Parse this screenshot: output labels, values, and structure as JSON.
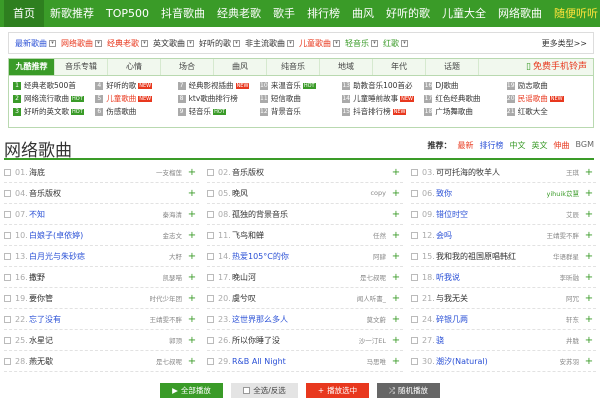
{
  "topnav": [
    "首页",
    "新歌推荐",
    "TOP500",
    "抖音歌曲",
    "经典老歌",
    "歌手",
    "排行榜",
    "曲风",
    "好听的歌",
    "儿童大全",
    "网络歌曲",
    "随便听听"
  ],
  "cats": [
    "最新歌曲",
    "网络歌曲",
    "经典老歌",
    "英文歌曲",
    "好听的歌",
    "非主流歌曲",
    "儿童歌曲",
    "轻音乐",
    "红歌"
  ],
  "cats_more": "更多类型>>",
  "tabs": [
    "九酷推荐",
    "音乐专辑",
    "心情",
    "场合",
    "曲风",
    "纯音乐",
    "地域",
    "年代",
    "话题"
  ],
  "free_ringtone": "免费手机铃声",
  "grid": [
    {
      "n": "1",
      "t": "经典老歌500首",
      "badge": ""
    },
    {
      "n": "4",
      "t": "好听的歌",
      "badge": "NEW"
    },
    {
      "n": "7",
      "t": "经典影视插曲",
      "badge": "NEW"
    },
    {
      "n": "10",
      "t": "来温音乐",
      "badge": "HOT"
    },
    {
      "n": "13",
      "t": "助教音乐100首必",
      "badge": ""
    },
    {
      "n": "16",
      "t": "DJ歌曲",
      "badge": ""
    },
    {
      "n": "19",
      "t": "励志歌曲",
      "badge": ""
    },
    {
      "n": "2",
      "t": "网络流行歌曲",
      "badge": "HOT"
    },
    {
      "n": "5",
      "t": "儿童歌曲",
      "badge": "NEW"
    },
    {
      "n": "8",
      "t": "ktv歌曲排行榜",
      "badge": ""
    },
    {
      "n": "11",
      "t": "短信歌曲",
      "badge": ""
    },
    {
      "n": "14",
      "t": "儿童睡前故事",
      "badge": "NEW"
    },
    {
      "n": "17",
      "t": "红色经典歌曲",
      "badge": ""
    },
    {
      "n": "20",
      "t": "民谣歌曲",
      "badge": "NEW"
    },
    {
      "n": "3",
      "t": "好听的英文歌",
      "badge": "HOT"
    },
    {
      "n": "6",
      "t": "伤感歌曲",
      "badge": ""
    },
    {
      "n": "9",
      "t": "轻音乐",
      "badge": "HOT"
    },
    {
      "n": "12",
      "t": "背景音乐",
      "badge": ""
    },
    {
      "n": "15",
      "t": "抖音排行榜",
      "badge": "NEW"
    },
    {
      "n": "18",
      "t": "广场舞歌曲",
      "badge": ""
    },
    {
      "n": "21",
      "t": "红歌大全",
      "badge": ""
    }
  ],
  "title": "网络歌曲",
  "rec_label": "推荐：",
  "rec_links": [
    "最新",
    "排行榜",
    "中文",
    "英文",
    "伸曲",
    "BGM"
  ],
  "songs": [
    {
      "num": "01.",
      "name": "海底",
      "artist": "一支榴莲"
    },
    {
      "num": "02.",
      "name": "音乐版权",
      "artist": ""
    },
    {
      "num": "03.",
      "name": "可可托海的牧羊人",
      "artist": "王琪"
    },
    {
      "num": "04.",
      "name": "音乐版权",
      "artist": ""
    },
    {
      "num": "05.",
      "name": "晚风",
      "artist": "copy"
    },
    {
      "num": "06.",
      "name": "致你",
      "artist": "yihuik苡慧"
    },
    {
      "num": "07.",
      "name": "不知",
      "artist": "秦海清"
    },
    {
      "num": "08.",
      "name": "孤独的背景音乐",
      "artist": ""
    },
    {
      "num": "09.",
      "name": "错位时空",
      "artist": "艾辰"
    },
    {
      "num": "10.",
      "name": "白娘子(卓依婷)",
      "artist": "金志文"
    },
    {
      "num": "11.",
      "name": "飞鸟和蝉",
      "artist": "任然"
    },
    {
      "num": "12.",
      "name": "会吗",
      "artist": "王靖雯不胖"
    },
    {
      "num": "13.",
      "name": "白月光与朱砂痣",
      "artist": "大籽"
    },
    {
      "num": "14.",
      "name": "热爱105°C的你",
      "artist": "阿肆"
    },
    {
      "num": "15.",
      "name": "我和我的祖国原唱韩红",
      "artist": "华语群星"
    },
    {
      "num": "16.",
      "name": "撒野",
      "artist": "凯瑟喵"
    },
    {
      "num": "17.",
      "name": "晚山河",
      "artist": "是七叔呢"
    },
    {
      "num": "18.",
      "name": "听我说",
      "artist": "李昕融"
    },
    {
      "num": "19.",
      "name": "要你管",
      "artist": "时代少年团"
    },
    {
      "num": "20.",
      "name": "虞兮叹",
      "artist": "闻人听書_"
    },
    {
      "num": "21.",
      "name": "与我无关",
      "artist": "阿冗"
    },
    {
      "num": "22.",
      "name": "忘了没有",
      "artist": "王靖雯不胖"
    },
    {
      "num": "23.",
      "name": "这世界那么多人",
      "artist": "莫文蔚"
    },
    {
      "num": "24.",
      "name": "碎银几两",
      "artist": "轩东"
    },
    {
      "num": "25.",
      "name": "水星记",
      "artist": "郭顶"
    },
    {
      "num": "26.",
      "name": "所以你睡了没",
      "artist": "沙一汀EL"
    },
    {
      "num": "27.",
      "name": "骁",
      "artist": "井胧"
    },
    {
      "num": "28.",
      "name": "燕无歇",
      "artist": "是七叔呢"
    },
    {
      "num": "29.",
      "name": "R&B All Night",
      "artist": "马思唯"
    },
    {
      "num": "30.",
      "name": "潮汐(Natural)",
      "artist": "安苏羽"
    }
  ],
  "buttons": {
    "play_all": "全部播放",
    "select": "全选/反选",
    "add": "播放选中",
    "random": "随机播放"
  }
}
